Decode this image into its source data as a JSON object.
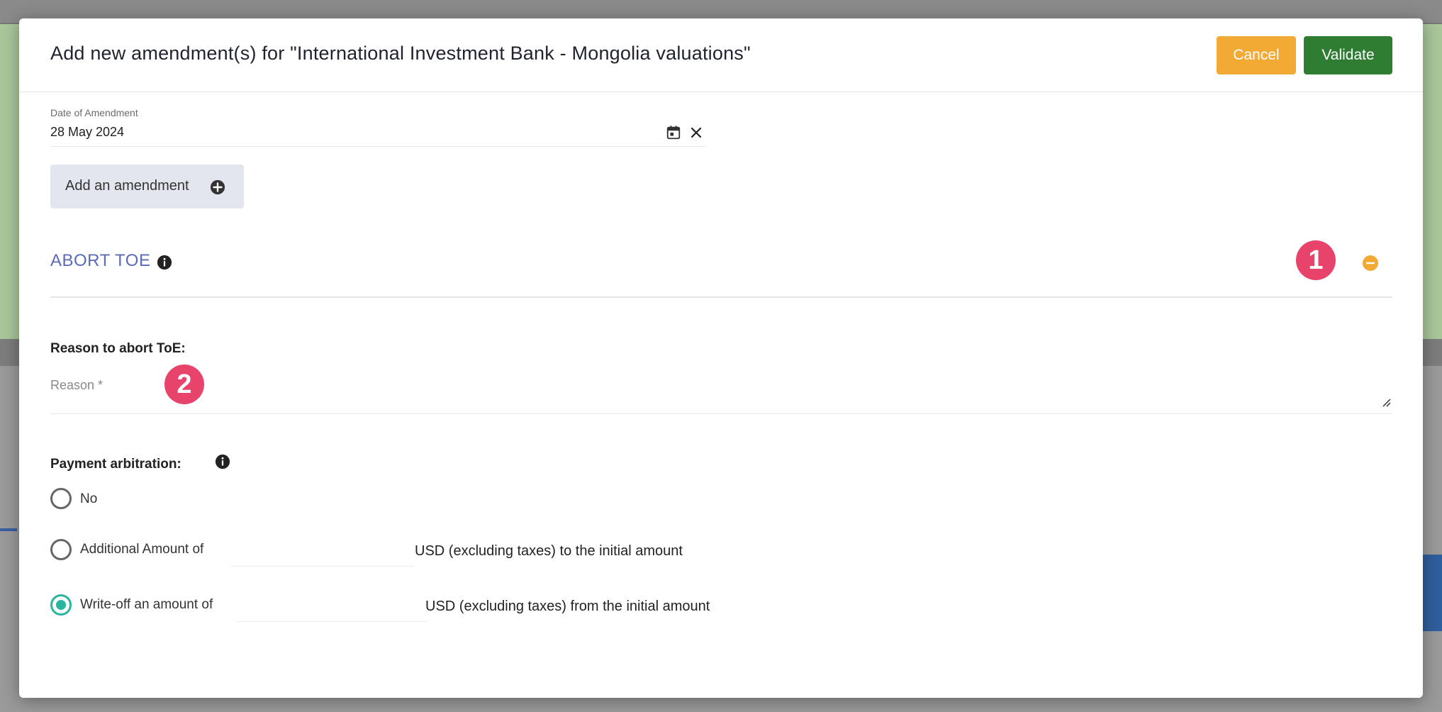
{
  "modal": {
    "title": "Add new amendment(s) for \"International Investment Bank - Mongolia valuations\"",
    "cancel_label": "Cancel",
    "validate_label": "Validate"
  },
  "date_field": {
    "label": "Date of Amendment",
    "value": "28 May 2024"
  },
  "add_amendment": {
    "label": "Add an amendment"
  },
  "section": {
    "title": "ABORT TOE",
    "marker_1": "1",
    "marker_2": "2"
  },
  "reason": {
    "heading": "Reason to abort ToE:",
    "placeholder": "Reason *"
  },
  "payment": {
    "heading": "Payment arbitration:",
    "options": [
      {
        "label": "No",
        "suffix": "",
        "checked": false
      },
      {
        "label": "Additional Amount of",
        "suffix": "USD (excluding taxes) to the initial amount",
        "checked": false
      },
      {
        "label": "Write-off an amount of",
        "suffix": "USD (excluding taxes) from the initial amount",
        "checked": true
      }
    ]
  },
  "colors": {
    "cancel": "#f2aa35",
    "validate": "#2e7d32",
    "section_title": "#5b6bb5",
    "marker": "#e8436b",
    "radio_checked": "#2bb5a0",
    "minus": "#f2aa35"
  }
}
